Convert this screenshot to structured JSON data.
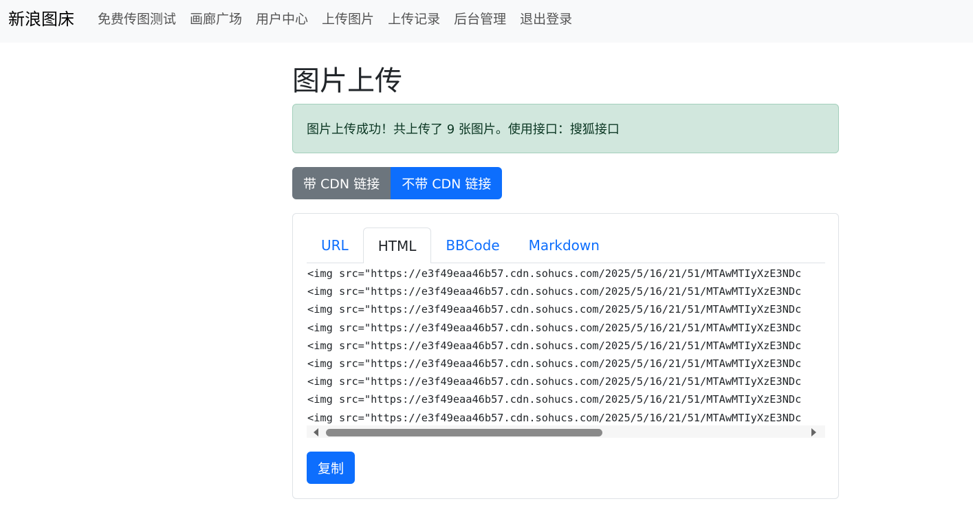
{
  "navbar": {
    "brand": "新浪图床",
    "links": [
      "免费传图测试",
      "画廊广场",
      "用户中心",
      "上传图片",
      "上传记录",
      "后台管理",
      "退出登录"
    ]
  },
  "page": {
    "title": "图片上传",
    "alert": "图片上传成功！共上传了 9 张图片。使用接口：搜狐接口"
  },
  "link_mode": {
    "with_cdn": "带 CDN 链接",
    "without_cdn": "不带 CDN 链接"
  },
  "tabs": [
    "URL",
    "HTML",
    "BBCode",
    "Markdown"
  ],
  "active_tab": "HTML",
  "code_lines": [
    "<img src=\"https://e3f49eaa46b57.cdn.sohucs.com/2025/5/16/21/51/MTAwMTIyXzE3NDc",
    "<img src=\"https://e3f49eaa46b57.cdn.sohucs.com/2025/5/16/21/51/MTAwMTIyXzE3NDc",
    "<img src=\"https://e3f49eaa46b57.cdn.sohucs.com/2025/5/16/21/51/MTAwMTIyXzE3NDc",
    "<img src=\"https://e3f49eaa46b57.cdn.sohucs.com/2025/5/16/21/51/MTAwMTIyXzE3NDc",
    "<img src=\"https://e3f49eaa46b57.cdn.sohucs.com/2025/5/16/21/51/MTAwMTIyXzE3NDc",
    "<img src=\"https://e3f49eaa46b57.cdn.sohucs.com/2025/5/16/21/51/MTAwMTIyXzE3NDc",
    "<img src=\"https://e3f49eaa46b57.cdn.sohucs.com/2025/5/16/21/51/MTAwMTIyXzE3NDc",
    "<img src=\"https://e3f49eaa46b57.cdn.sohucs.com/2025/5/16/21/51/MTAwMTIyXzE3NDc",
    "<img src=\"https://e3f49eaa46b57.cdn.sohucs.com/2025/5/16/21/51/MTAwMTIyXzE3NDc"
  ],
  "copy_button": "复制",
  "colors": {
    "primary": "#0d6efd",
    "secondary": "#6c757d",
    "success_bg": "#d1e7dd",
    "navbar_bg": "#f8f9fa"
  }
}
